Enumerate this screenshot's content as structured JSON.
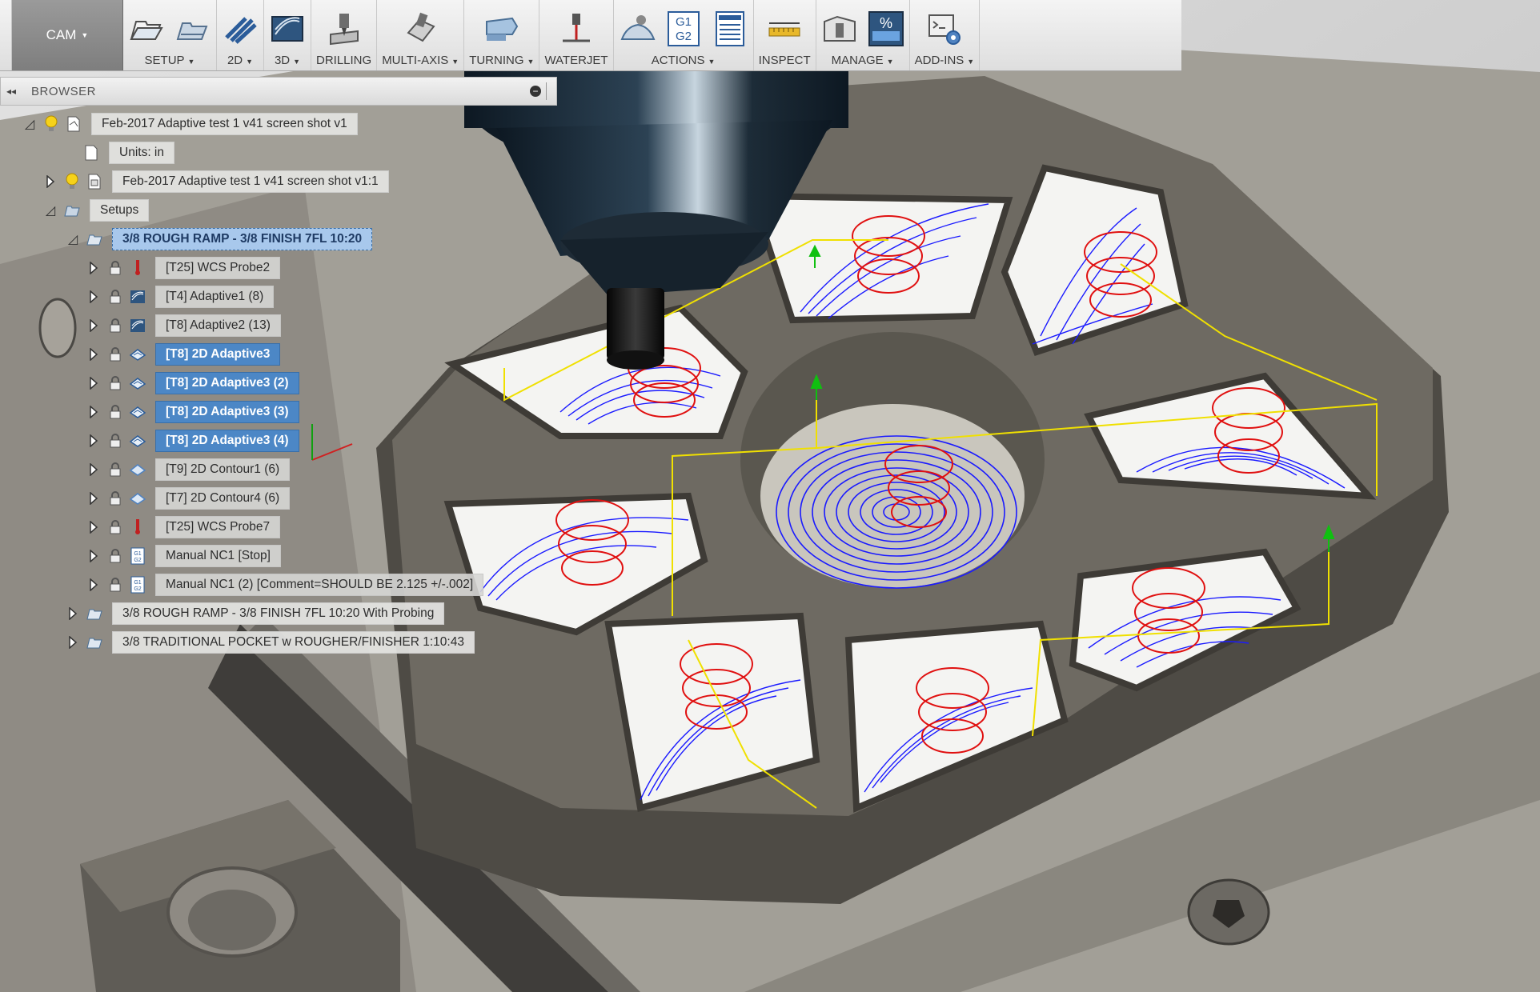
{
  "toolbar": {
    "workspace": "CAM",
    "groups": [
      {
        "label": "SETUP",
        "dropdown": true
      },
      {
        "label": "2D",
        "dropdown": true
      },
      {
        "label": "3D",
        "dropdown": true
      },
      {
        "label": "DRILLING",
        "dropdown": false
      },
      {
        "label": "MULTI-AXIS",
        "dropdown": true
      },
      {
        "label": "TURNING",
        "dropdown": true
      },
      {
        "label": "WATERJET",
        "dropdown": false
      },
      {
        "label": "ACTIONS",
        "dropdown": true
      },
      {
        "label": "INSPECT",
        "dropdown": false
      },
      {
        "label": "MANAGE",
        "dropdown": true
      },
      {
        "label": "ADD-INS",
        "dropdown": true
      }
    ],
    "icons": {
      "setup": [
        "new-setup-icon",
        "setup-folder-icon"
      ],
      "2d": [
        "2d-adaptive-icon"
      ],
      "3d": [
        "3d-adaptive-icon"
      ],
      "drilling": [
        "drill-icon"
      ],
      "multiaxis": [
        "multi-axis-icon"
      ],
      "turning": [
        "turning-icon"
      ],
      "waterjet": [
        "waterjet-icon"
      ],
      "actions": [
        "simulate-icon",
        "post-process-icon",
        "setup-sheet-icon"
      ],
      "inspect": [
        "measure-icon"
      ],
      "manage": [
        "tool-library-icon",
        "feed-speed-icon"
      ],
      "addins": [
        "scripts-addins-icon"
      ]
    },
    "g1g2_text": [
      "G1",
      "G2"
    ],
    "percent_glyph": "%"
  },
  "browser": {
    "title": "BROWSER",
    "nodes": [
      {
        "label": "Feb-2017 Adaptive test 1 v41 screen shot v1",
        "icon": "document-icon",
        "expand": "open"
      },
      {
        "label": "Units: in",
        "icon": "units-icon",
        "expand": "none"
      },
      {
        "label": "Feb-2017 Adaptive test 1 v41 screen shot v1:1",
        "icon": "component-icon",
        "expand": "closed"
      },
      {
        "label": "Setups",
        "icon": "setups-folder-icon",
        "expand": "open"
      },
      {
        "label": "3/8 ROUGH RAMP - 3/8 FINISH 7FL 10:20",
        "icon": "setup-icon",
        "expand": "open"
      },
      {
        "label": "[T25] WCS Probe2",
        "icon": "probe-icon"
      },
      {
        "label": "[T4] Adaptive1 (8)",
        "icon": "adaptive-icon"
      },
      {
        "label": "[T8] Adaptive2 (13)",
        "icon": "adaptive-icon"
      },
      {
        "label": "[T8] 2D Adaptive3",
        "icon": "2d-adaptive-icon"
      },
      {
        "label": "[T8] 2D Adaptive3 (2)",
        "icon": "2d-adaptive-icon"
      },
      {
        "label": "[T8] 2D Adaptive3 (3)",
        "icon": "2d-adaptive-icon"
      },
      {
        "label": "[T8] 2D Adaptive3 (4)",
        "icon": "2d-adaptive-icon"
      },
      {
        "label": "[T9] 2D Contour1 (6)",
        "icon": "2d-contour-icon"
      },
      {
        "label": "[T7] 2D Contour4 (6)",
        "icon": "2d-contour-icon"
      },
      {
        "label": "[T25] WCS Probe7",
        "icon": "probe-icon"
      },
      {
        "label": "Manual NC1 [Stop]",
        "icon": "manual-nc-icon"
      },
      {
        "label": "Manual NC1 (2) [Comment=SHOULD BE 2.125 +/-.002]",
        "icon": "manual-nc-icon"
      },
      {
        "label": "3/8 ROUGH RAMP - 3/8 FINISH 7FL 10:20 With Probing",
        "icon": "setup-icon",
        "expand": "closed"
      },
      {
        "label": "3/8 TRADITIONAL POCKET w ROUGHER/FINISHER 1:10:43",
        "icon": "setup-icon",
        "expand": "closed"
      }
    ],
    "selected_setup": "3/8 ROUGH RAMP - 3/8 FINISH 7FL 10:20",
    "selected_operations": [
      "[T8] 2D Adaptive3",
      "[T8] 2D Adaptive3 (2)",
      "[T8] 2D Adaptive3 (3)",
      "[T8] 2D Adaptive3 (4)"
    ]
  },
  "colors": {
    "selection": "#4c87c6",
    "toolpath_feed": "#1a1aff",
    "toolpath_ramp": "#e01010",
    "toolpath_link": "#f0e000",
    "toolpath_highfeed": "#cccc00",
    "part_dark": "#55524c",
    "stock_cavity": "#f2f2f0"
  }
}
